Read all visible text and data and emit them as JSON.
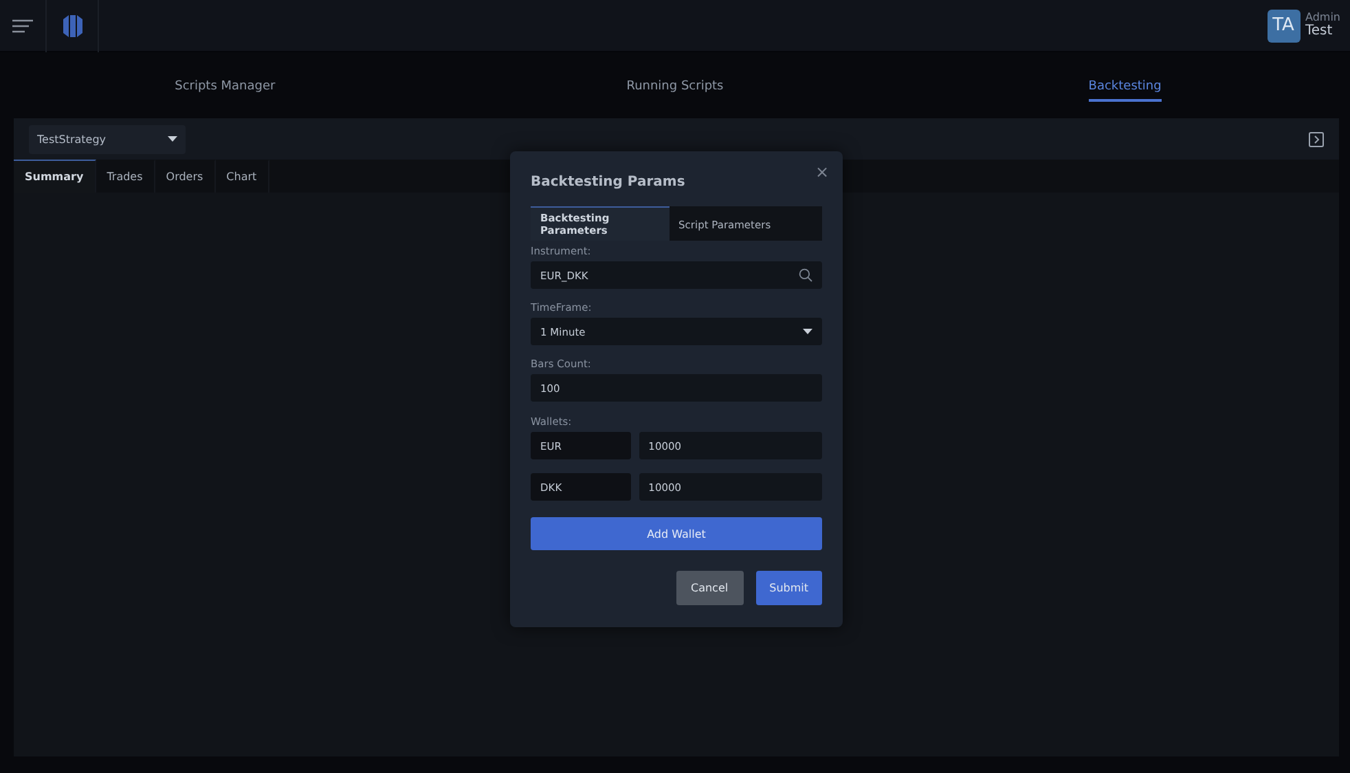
{
  "header": {
    "avatar": "TA",
    "role": "Admin",
    "user": "Test"
  },
  "nav": [
    {
      "label": "Scripts Manager",
      "selected": false
    },
    {
      "label": "Running Scripts",
      "selected": false
    },
    {
      "label": "Backtesting",
      "selected": true
    }
  ],
  "strategy_select": {
    "value": "TestStrategy"
  },
  "result_tabs": [
    {
      "label": "Summary",
      "selected": true
    },
    {
      "label": "Trades",
      "selected": false
    },
    {
      "label": "Orders",
      "selected": false
    },
    {
      "label": "Chart",
      "selected": false
    }
  ],
  "dialog": {
    "title": "Backtesting Params",
    "close": "×",
    "tabs": [
      {
        "label": "Backtesting Parameters",
        "selected": true
      },
      {
        "label": "Script Parameters",
        "selected": false
      }
    ],
    "fields": [
      {
        "kind": "search",
        "label": "Instrument:",
        "value": "EUR_DKK"
      },
      {
        "kind": "select",
        "label": "TimeFrame:",
        "value": "1 Minute"
      },
      {
        "kind": "text",
        "label": "Bars Count:",
        "value": "100"
      }
    ],
    "wallets_label": "Wallets:",
    "wallets": [
      {
        "currency": "EUR",
        "amount": "10000"
      },
      {
        "currency": "DKK",
        "amount": "10000"
      }
    ],
    "add_wallet": "Add Wallet",
    "buttons": [
      {
        "kind": "secondary",
        "label": "Cancel"
      },
      {
        "kind": "primary",
        "label": "Submit"
      }
    ]
  }
}
